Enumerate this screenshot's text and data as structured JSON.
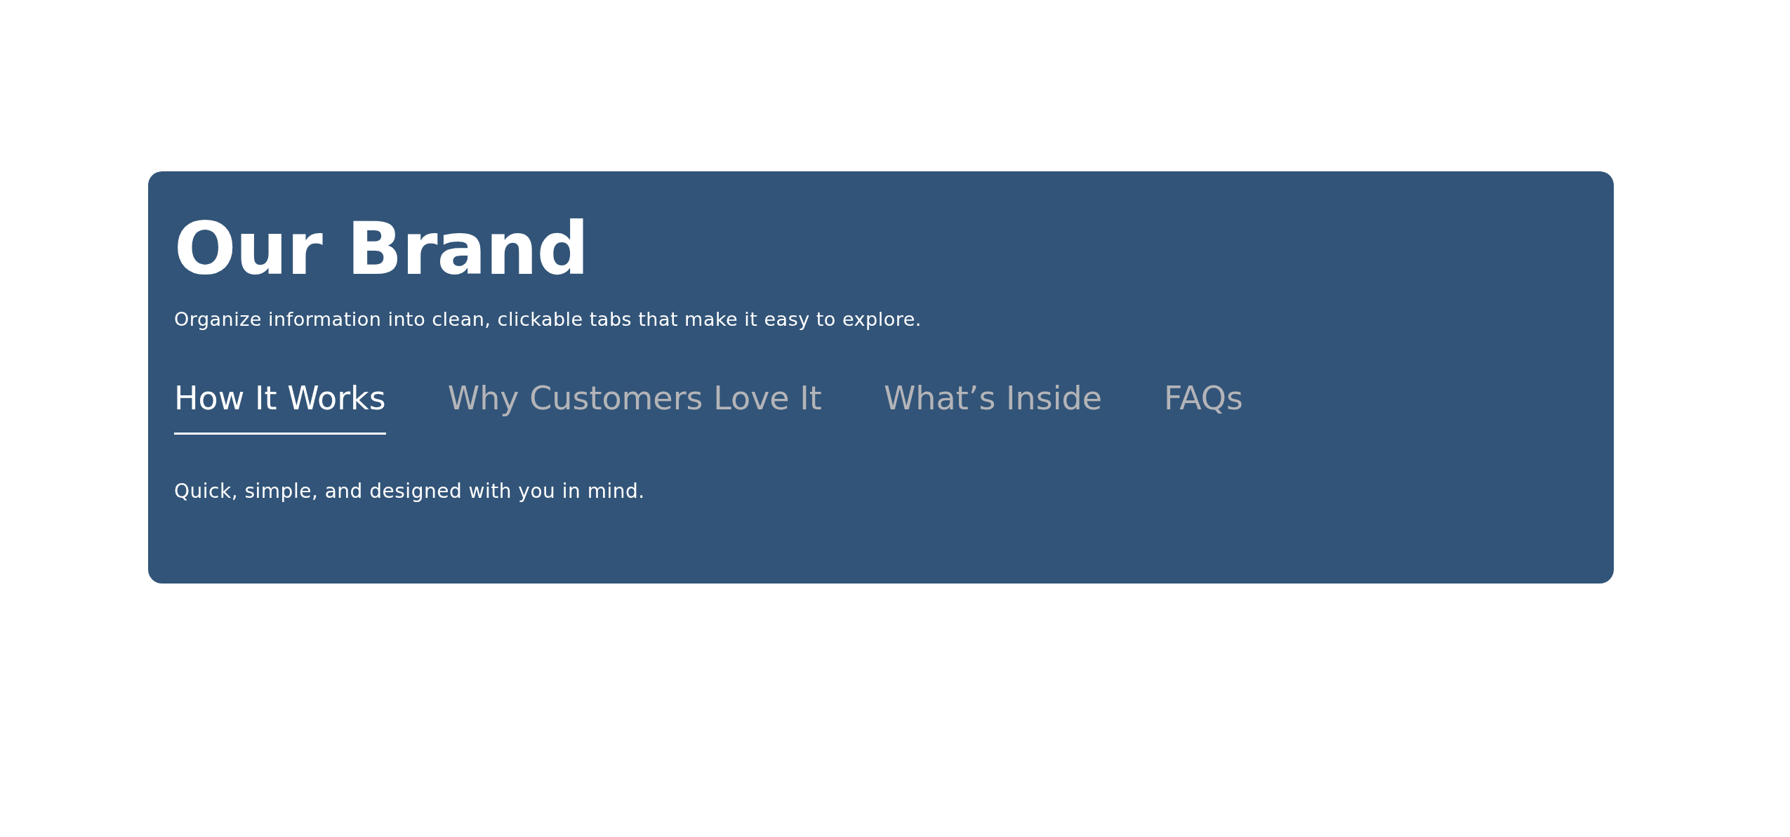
{
  "brand": {
    "title": "Our Brand",
    "subtitle": "Organize information into clean, clickable tabs that make it easy to explore."
  },
  "tabs": [
    {
      "label": "How It Works",
      "selected": true
    },
    {
      "label": "Why Customers Love It",
      "selected": false
    },
    {
      "label": "What’s Inside",
      "selected": false
    },
    {
      "label": "FAQs",
      "selected": false
    }
  ],
  "panel": {
    "text": "Quick, simple, and designed with you in mind."
  }
}
